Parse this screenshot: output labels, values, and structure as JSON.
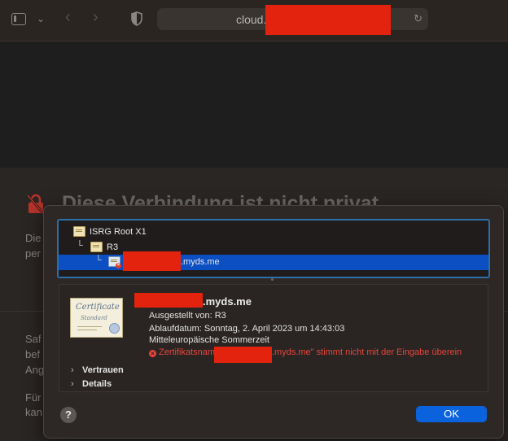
{
  "browser": {
    "url_visible": "cloud."
  },
  "background_page": {
    "title_partial": "Diese Verbindung ist nicht privat",
    "para1_fragments": [
      "Die",
      "per"
    ],
    "para2_fragments": [
      "Saf",
      "bef",
      "Ang"
    ],
    "para3_fragments": [
      "Für",
      "kan"
    ]
  },
  "cert_chain": {
    "items": [
      {
        "label": "ISRG Root X1"
      },
      {
        "label": "R3"
      },
      {
        "label": ".myds.me"
      }
    ]
  },
  "cert_details": {
    "common_name_suffix": ".myds.me",
    "issued_by": "Ausgestellt von: R3",
    "expiry": "Ablaufdatum: Sonntag, 2. April 2023 um 14:43:03",
    "timezone": "Mitteleuropäische Sommerzeit",
    "error_prefix": "Zertifikatsname „",
    "error_suffix": ".myds.me\" stimmt nicht mit der Eingabe überein",
    "image_text_1": "Certificate",
    "image_text_2": "Standard"
  },
  "disclosures": {
    "trust": "Vertrauen",
    "details": "Details"
  },
  "buttons": {
    "help": "?",
    "ok": "OK"
  },
  "colors": {
    "accent": "#0a63dd",
    "selection": "#0b4fc2",
    "error": "#e8453c",
    "redaction": "#e3230e"
  }
}
